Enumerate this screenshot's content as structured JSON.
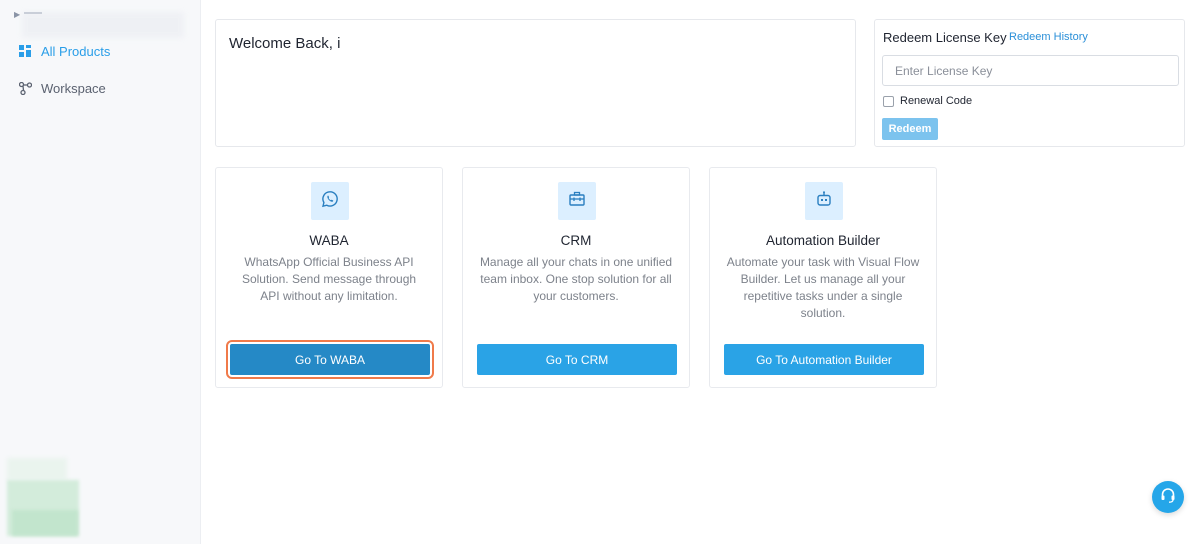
{
  "sidebar": {
    "items": [
      {
        "label": "All Products",
        "icon": "grid-icon"
      },
      {
        "label": "Workspace",
        "icon": "nodes-icon"
      }
    ]
  },
  "welcome": {
    "text": "Welcome Back, i"
  },
  "redeem": {
    "title": "Redeem License Key",
    "history_link": "Redeem History",
    "placeholder": "Enter License Key",
    "renewal_label": "Renewal Code",
    "button_label": "Redeem"
  },
  "products": [
    {
      "name": "WABA",
      "description": "WhatsApp Official Business API Solution. Send message through API without any limitation.",
      "button": "Go To WABA",
      "icon": "whatsapp-icon"
    },
    {
      "name": "CRM",
      "description": "Manage all your chats in one unified team inbox. One stop solution for all your customers.",
      "button": "Go To CRM",
      "icon": "briefcase-icon"
    },
    {
      "name": "Automation Builder",
      "description": "Automate your task with Visual Flow Builder. Let us manage all your repetitive tasks under a single solution.",
      "button": "Go To Automation Builder",
      "icon": "robot-icon"
    }
  ],
  "colors": {
    "accent": "#2aa3e6",
    "focus_outline": "#f07a4a",
    "icon_bg": "#dcefff"
  }
}
